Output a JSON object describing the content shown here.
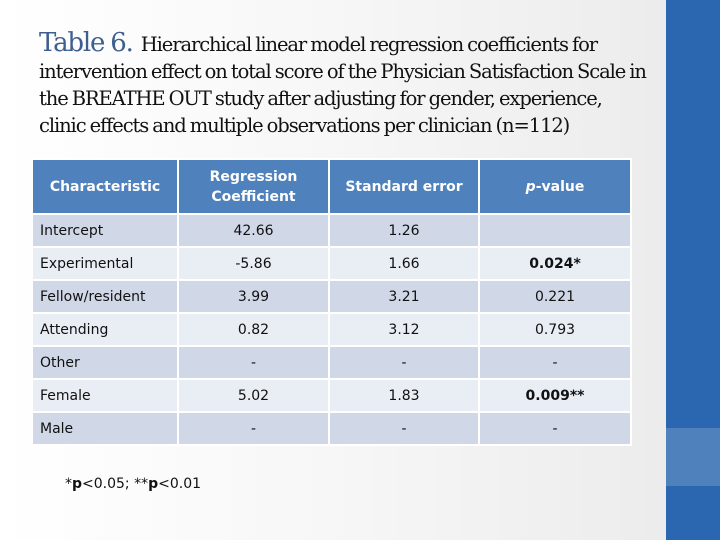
{
  "title": {
    "label": "Table 6.",
    "text": "Hierarchical linear model regression coefficients for intervention effect on total score of the Physician Satisfaction Scale in the BREATHE OUT study after adjusting for gender, experience, clinic effects and multiple observations per clinician (n=112)"
  },
  "table": {
    "headers": {
      "characteristic": "Characteristic",
      "coefficient_line1": "Regression",
      "coefficient_line2": "Coefficient",
      "std_error": "Standard error",
      "pvalue_p": "p",
      "pvalue_rest": "-value"
    },
    "rows": [
      {
        "characteristic": "Intercept",
        "coefficient": "42.66",
        "std_error": "1.26",
        "pvalue": "",
        "significant": false
      },
      {
        "characteristic": "Experimental",
        "coefficient": "-5.86",
        "std_error": "1.66",
        "pvalue": "0.024*",
        "significant": true
      },
      {
        "characteristic": "Fellow/resident",
        "coefficient": "3.99",
        "std_error": "3.21",
        "pvalue": "0.221",
        "significant": false
      },
      {
        "characteristic": "Attending",
        "coefficient": "0.82",
        "std_error": "3.12",
        "pvalue": "0.793",
        "significant": false
      },
      {
        "characteristic": "Other",
        "coefficient": "-",
        "std_error": "-",
        "pvalue": "-",
        "significant": false
      },
      {
        "characteristic": "Female",
        "coefficient": "5.02",
        "std_error": "1.83",
        "pvalue": "0.009**",
        "significant": true
      },
      {
        "characteristic": "Male",
        "coefficient": "-",
        "std_error": "-",
        "pvalue": "-",
        "significant": false
      }
    ]
  },
  "footnote": {
    "star1": "*",
    "p1": "p",
    "text1": "<0.05; ",
    "star2": "**",
    "p2": "p",
    "text2": "<0.01"
  },
  "colors": {
    "header_bg": "#4f81bd",
    "row_odd": "#d0d8e8",
    "row_even": "#e9edf4",
    "significant": "#c00000",
    "title_label": "#3d5f8f",
    "side_panel": "#2b66b0",
    "side_panel_band": "#4f82bd"
  }
}
